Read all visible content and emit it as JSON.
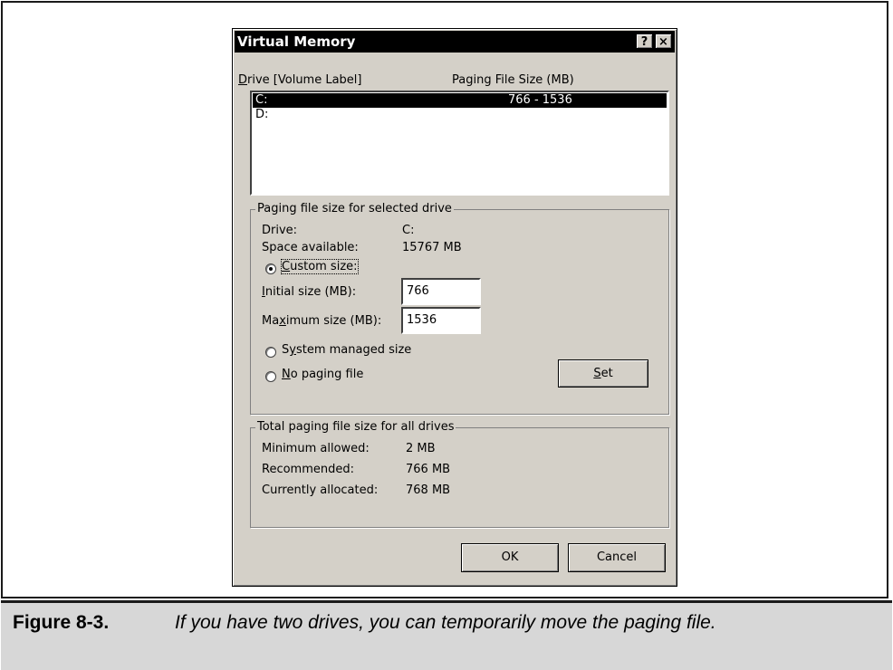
{
  "dialog": {
    "title": "Virtual Memory",
    "help_button": "?",
    "close_button": "×"
  },
  "drive_list": {
    "header_drive": "Drive  [Volume Label]",
    "header_size": "Paging File Size (MB)",
    "rows": [
      {
        "drive": "C:",
        "size": "766 - 1536",
        "selected": true
      },
      {
        "drive": "D:",
        "size": "",
        "selected": false
      }
    ]
  },
  "selected_drive": {
    "legend": "Paging file size for selected drive",
    "drive_label": "Drive:",
    "drive_value": "C:",
    "space_label": "Space available:",
    "space_value": "15767 MB",
    "custom_size_label": "Custom size:",
    "initial_label": "Initial size (MB):",
    "initial_value": "766",
    "maximum_label": "Maximum size (MB):",
    "maximum_value": "1536",
    "system_managed_label": "System managed size",
    "no_paging_label": "No paging file",
    "set_button": "Set",
    "selected_option": "custom"
  },
  "totals": {
    "legend": "Total paging file size for all drives",
    "min_label": "Minimum allowed:",
    "min_value": "2 MB",
    "rec_label": "Recommended:",
    "rec_value": "766 MB",
    "cur_label": "Currently allocated:",
    "cur_value": "768 MB"
  },
  "buttons": {
    "ok": "OK",
    "cancel": "Cancel"
  },
  "caption": {
    "figure": "Figure 8-3.",
    "text": "If you have two drives, you can temporarily move the paging file."
  }
}
